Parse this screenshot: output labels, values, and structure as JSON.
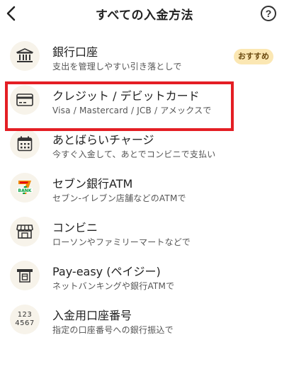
{
  "header": {
    "title": "すべての入金方法",
    "help_label": "?"
  },
  "methods": [
    {
      "title": "銀行口座",
      "subtitle": "支出を管理しやすい引き落としで",
      "badge": "おすすめ",
      "icon": "bank-icon"
    },
    {
      "title": "クレジット / デビットカード",
      "subtitle": "Visa / Mastercard / JCB / アメックスで",
      "icon": "credit-card-icon"
    },
    {
      "title": "あとばらいチャージ",
      "subtitle": "今すぐ入金して、あとでコンビニで支払い",
      "icon": "calendar-icon"
    },
    {
      "title": "セブン銀行ATM",
      "subtitle": "セブン-イレブン店舗などのATMで",
      "icon": "seven-bank-logo-icon",
      "logo_text": "BANK"
    },
    {
      "title": "コンビニ",
      "subtitle": "ローソンやファミリーマートなどで",
      "icon": "store-icon"
    },
    {
      "title": "Pay-easy (ペイジー)",
      "subtitle": "ネットバンキングや銀行ATMで",
      "icon": "atm-icon"
    },
    {
      "title": "入金用口座番号",
      "subtitle": "指定の口座番号への銀行振込で",
      "icon": "account-number-icon",
      "icon_text_top": "123",
      "icon_text_bottom": "4567"
    }
  ],
  "colors": {
    "highlight_border": "#e41e24",
    "badge_bg": "#fbe7b3",
    "icon_bg": "#f7f3ea"
  }
}
